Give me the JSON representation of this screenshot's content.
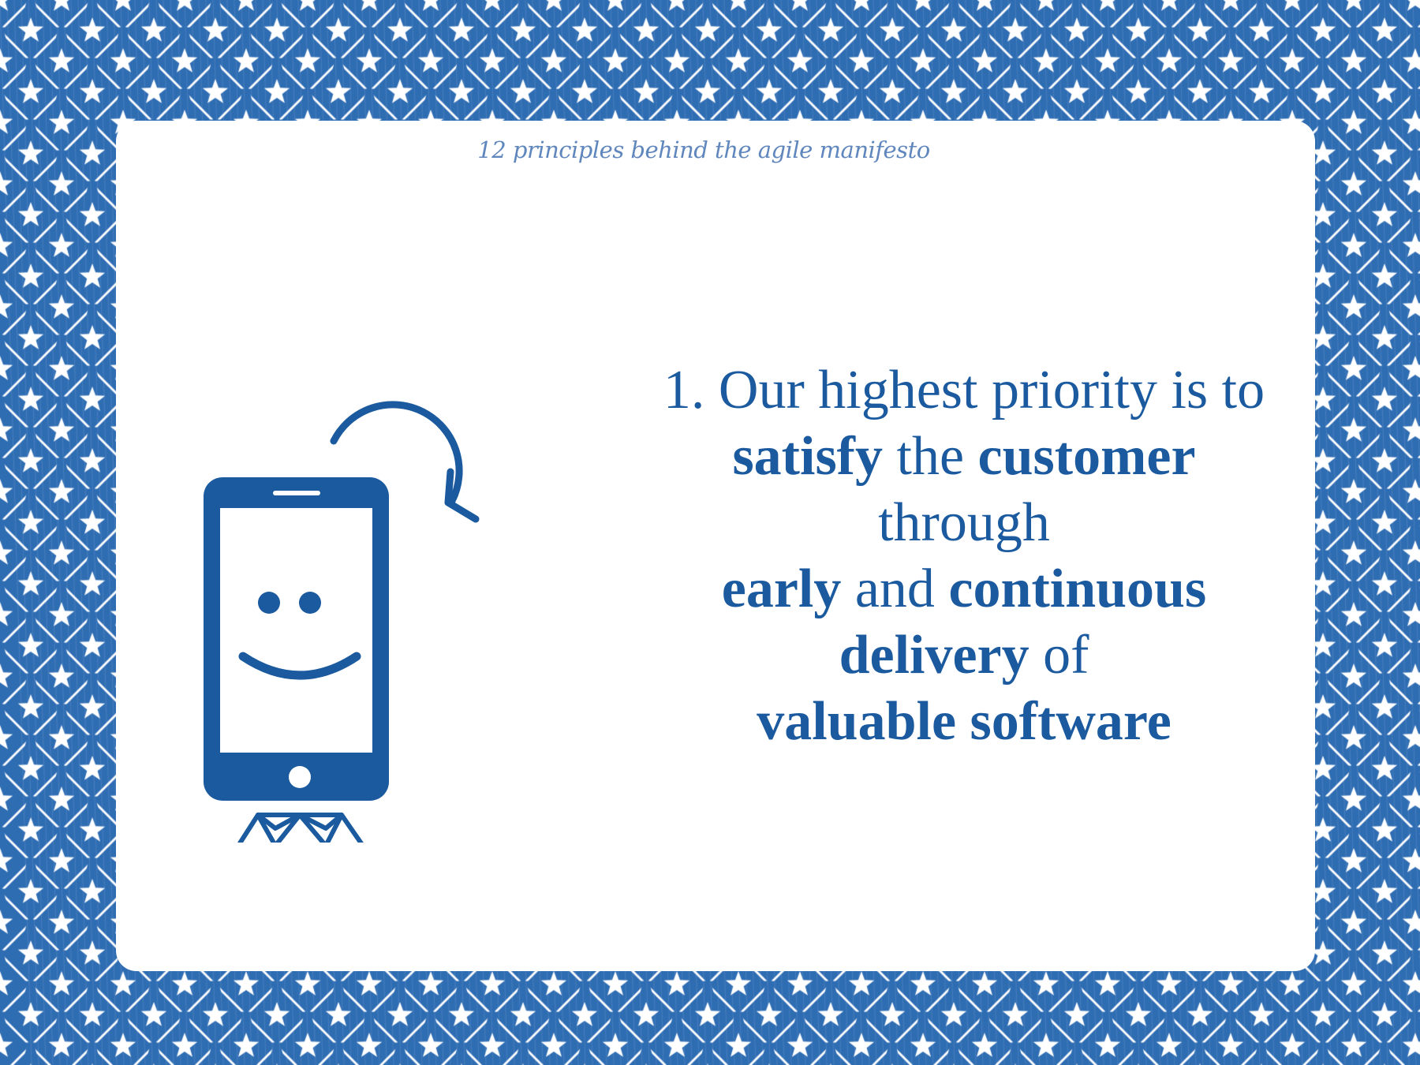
{
  "slide": {
    "kicker": "12 principles behind the agile manifesto",
    "principle": {
      "number": "1.",
      "lines": [
        [
          {
            "text": "1. Our highest priority is to",
            "bold": false
          }
        ],
        [
          {
            "text": "satisfy",
            "bold": true
          },
          {
            "text": " the ",
            "bold": false
          },
          {
            "text": "customer",
            "bold": true
          }
        ],
        [
          {
            "text": "through",
            "bold": false
          }
        ],
        [
          {
            "text": "early",
            "bold": true
          },
          {
            "text": " and ",
            "bold": false
          },
          {
            "text": "continuous",
            "bold": true
          }
        ],
        [
          {
            "text": "delivery",
            "bold": true
          },
          {
            "text": " of",
            "bold": false
          }
        ],
        [
          {
            "text": "valuable software",
            "bold": true
          }
        ]
      ]
    },
    "illustration": {
      "icons": [
        "smiling-phone-icon",
        "circular-arrow-icon",
        "diamond-icon"
      ]
    }
  },
  "colors": {
    "primary_blue": "#1b5a9f",
    "pattern_blue": "#2f6db3",
    "kicker_blue": "#5f86bd",
    "background": "#ffffff"
  },
  "border_pattern": {
    "motif": "star-on-diamond",
    "colors": [
      "#2f6db3",
      "#ffffff"
    ]
  }
}
